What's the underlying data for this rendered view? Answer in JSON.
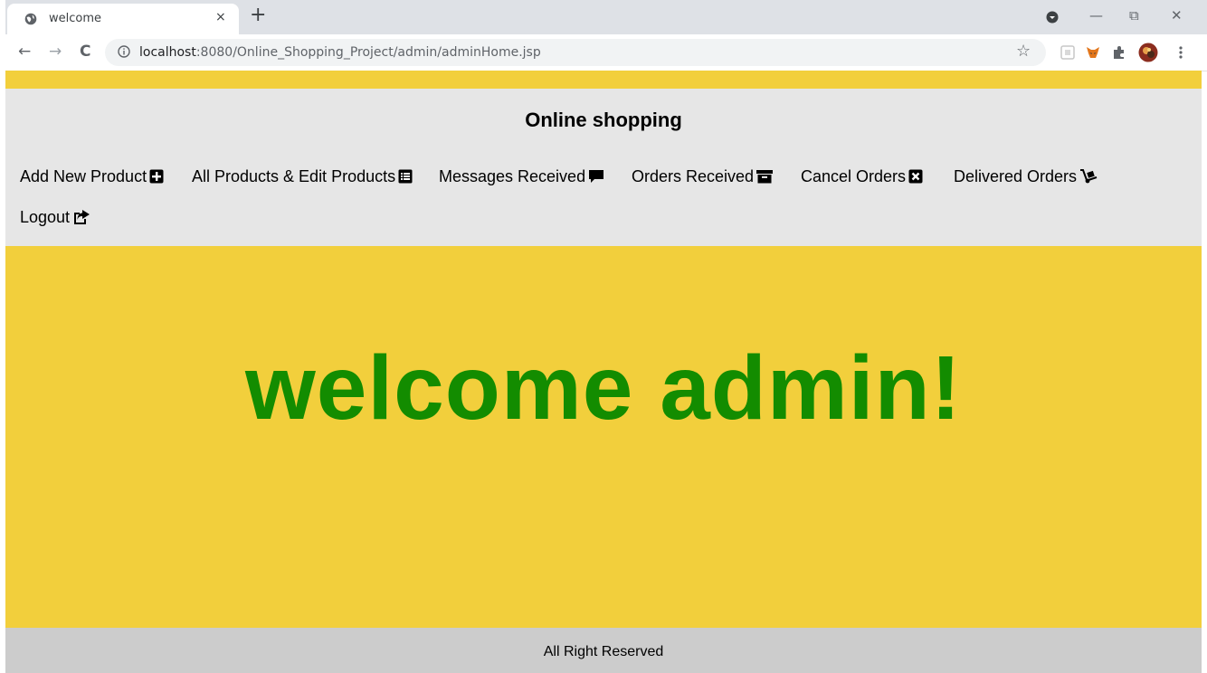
{
  "browser": {
    "tab_title": "welcome",
    "tab_close": "×",
    "new_tab": "+",
    "url_host": "localhost",
    "url_rest": ":8080/Online_Shopping_Project/admin/adminHome.jsp",
    "back": "←",
    "forward": "→",
    "reload": "C",
    "bookmark": "☆",
    "window_controls": {
      "minimize": "—",
      "restore": "⧉",
      "close": "✕"
    }
  },
  "site": {
    "title": "Online shopping",
    "nav": [
      {
        "label": "Add New Product",
        "icon": "plus-square-icon"
      },
      {
        "label": "All Products & Edit Products",
        "icon": "list-alt-icon"
      },
      {
        "label": "Messages Received",
        "icon": "comment-icon"
      },
      {
        "label": "Orders Received",
        "icon": "archive-icon"
      },
      {
        "label": "Cancel Orders",
        "icon": "times-square-icon"
      },
      {
        "label": "Delivered Orders",
        "icon": "dolly-icon"
      },
      {
        "label": "Logout",
        "icon": "share-square-icon"
      }
    ],
    "welcome": "welcome admin!",
    "footer": "All Right Reserved"
  },
  "colors": {
    "banner_yellow": "#f2cf3c",
    "header_gray": "#e6e6e6",
    "welcome_green": "#138c00",
    "footer_gray": "#cccccc"
  }
}
